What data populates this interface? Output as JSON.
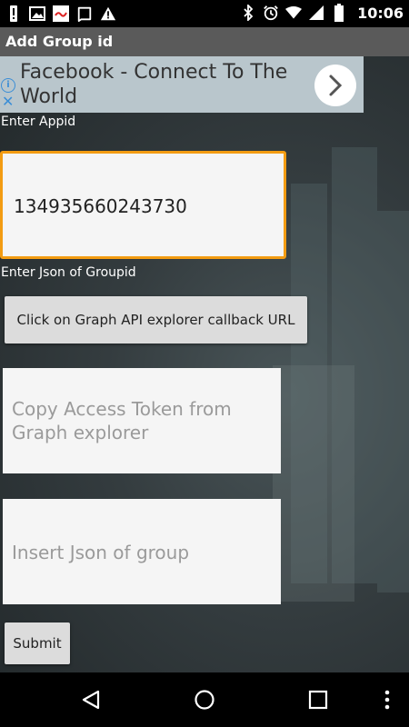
{
  "status_bar": {
    "time": "10:06",
    "left_icons": [
      "notification-icon",
      "image-icon",
      "app-icon",
      "chat-icon",
      "warning-icon"
    ],
    "right_icons": [
      "bluetooth-icon",
      "alarm-icon",
      "wifi-icon",
      "signal-icon",
      "battery-icon"
    ]
  },
  "title_bar": {
    "title": "Add Group id"
  },
  "ad": {
    "text": "Facebook - Connect To The World"
  },
  "form": {
    "appid_label": "Enter Appid",
    "appid_value": "134935660243730",
    "json_label": "Enter Json of Groupid",
    "graph_button_label": "Click on Graph API explorer callback URL",
    "token_placeholder": "Copy Access Token from Graph explorer",
    "json_placeholder": "Insert Json of group",
    "submit_label": "Submit"
  },
  "nav_bar": {
    "buttons": [
      "back-icon",
      "home-icon",
      "recents-icon",
      "more-icon"
    ]
  }
}
